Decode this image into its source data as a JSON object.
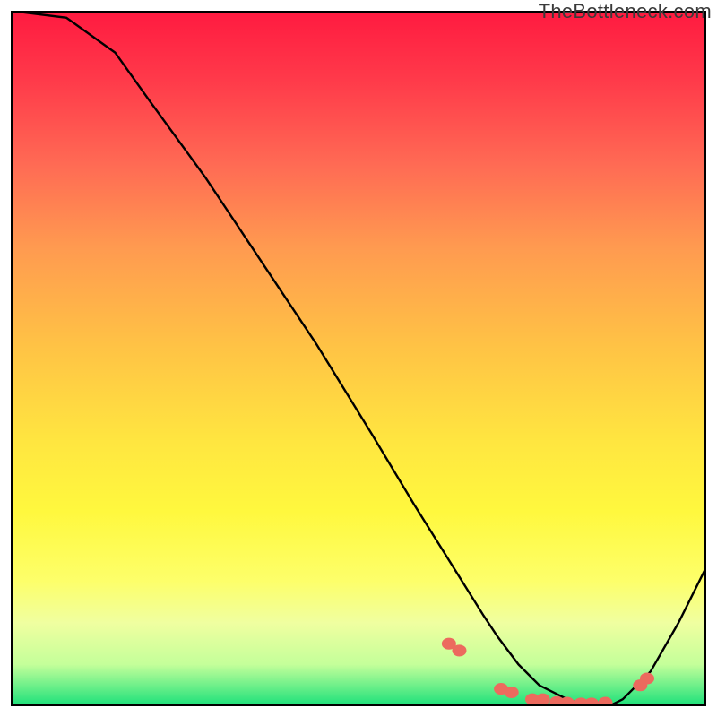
{
  "watermark": "TheBottleneck.com",
  "chart_data": {
    "type": "line",
    "title": "",
    "xlabel": "",
    "ylabel": "",
    "xlim": [
      0,
      100
    ],
    "ylim": [
      0,
      100
    ],
    "series": [
      {
        "name": "curve",
        "x": [
          0,
          8,
          15,
          20,
          28,
          36,
          44,
          52,
          58,
          63,
          68,
          70,
          73,
          76,
          80,
          83,
          86,
          88,
          92,
          96,
          100
        ],
        "y": [
          100,
          99,
          94,
          87,
          76,
          64,
          52,
          39,
          29,
          21,
          13,
          10,
          6,
          3,
          1,
          0,
          0,
          1,
          5,
          12,
          20
        ]
      }
    ],
    "markers": {
      "name": "dots",
      "color": "#ec6a5e",
      "size": 8,
      "points": [
        {
          "x": 63,
          "y": 9
        },
        {
          "x": 64.5,
          "y": 8
        },
        {
          "x": 70.5,
          "y": 2.5
        },
        {
          "x": 72,
          "y": 2
        },
        {
          "x": 75,
          "y": 1
        },
        {
          "x": 76.5,
          "y": 1
        },
        {
          "x": 78.5,
          "y": 0.6
        },
        {
          "x": 80,
          "y": 0.5
        },
        {
          "x": 82,
          "y": 0.4
        },
        {
          "x": 83.5,
          "y": 0.4
        },
        {
          "x": 85.5,
          "y": 0.5
        },
        {
          "x": 90.5,
          "y": 3
        },
        {
          "x": 91.5,
          "y": 4
        }
      ]
    },
    "gradient_stops": [
      {
        "pos": 0.0,
        "color": "#ff1a40"
      },
      {
        "pos": 0.1,
        "color": "#ff3a4a"
      },
      {
        "pos": 0.22,
        "color": "#ff6a54"
      },
      {
        "pos": 0.34,
        "color": "#ff9a50"
      },
      {
        "pos": 0.48,
        "color": "#ffc245"
      },
      {
        "pos": 0.62,
        "color": "#ffe640"
      },
      {
        "pos": 0.72,
        "color": "#fff83e"
      },
      {
        "pos": 0.82,
        "color": "#fdff6a"
      },
      {
        "pos": 0.88,
        "color": "#f0ffa0"
      },
      {
        "pos": 0.94,
        "color": "#c4ff9a"
      },
      {
        "pos": 1.0,
        "color": "#1ae07a"
      }
    ]
  }
}
